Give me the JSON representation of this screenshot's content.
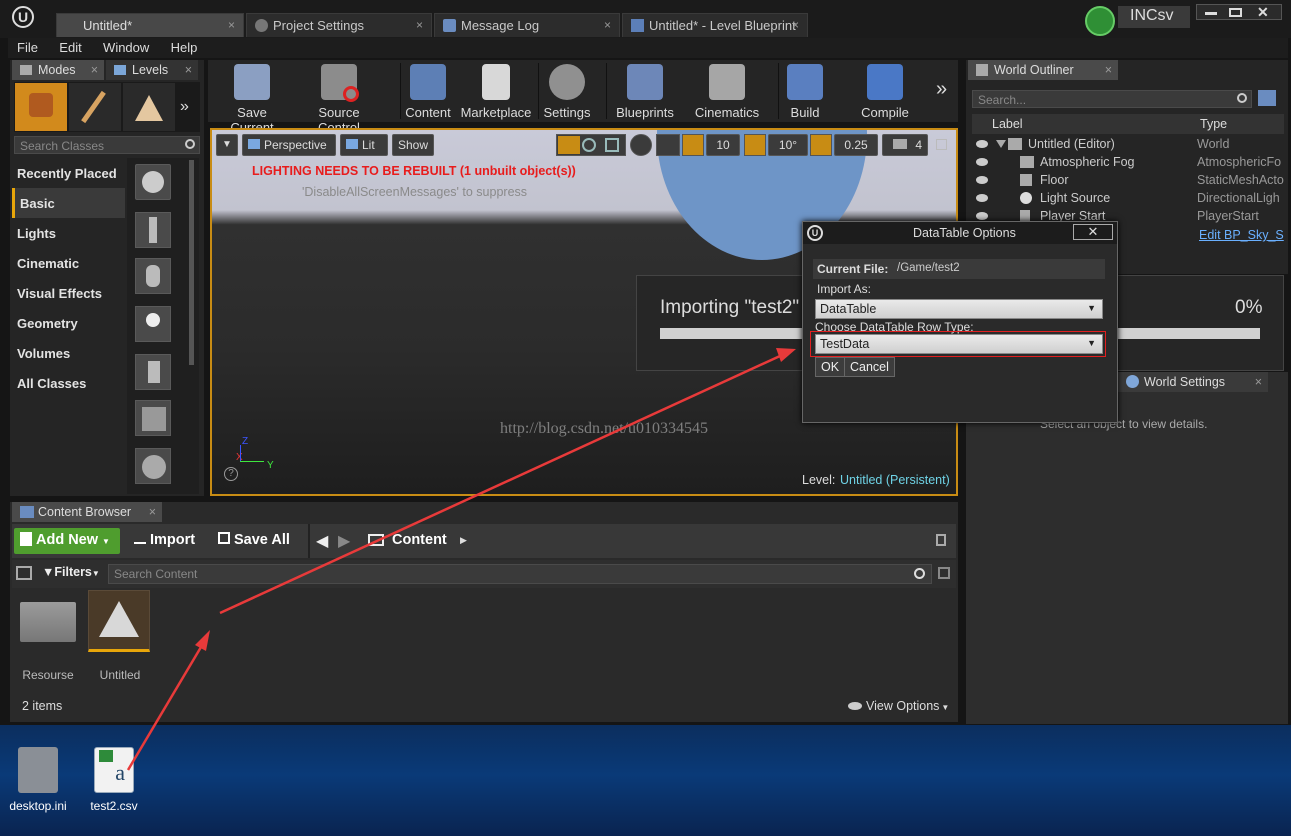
{
  "tabs": [
    {
      "label": "Untitled*",
      "close": "×"
    },
    {
      "label": "Project Settings",
      "close": "×"
    },
    {
      "label": "Message Log",
      "close": "×"
    },
    {
      "label": "Untitled* - Level Blueprint",
      "close": "×"
    }
  ],
  "user": {
    "name": "INCsv"
  },
  "menu": [
    "File",
    "Edit",
    "Window",
    "Help"
  ],
  "modes_tab": {
    "label": "Modes",
    "close": "×"
  },
  "levels_tab": {
    "label": "Levels",
    "close": "×"
  },
  "toolbar": [
    "Save Current",
    "Source Control",
    "Content",
    "Marketplace",
    "Settings",
    "Blueprints",
    "Cinematics",
    "Build",
    "Compile"
  ],
  "place": {
    "search_placeholder": "Search Classes",
    "categories": [
      "Recently Placed",
      "Basic",
      "Lights",
      "Cinematic",
      "Visual Effects",
      "Geometry",
      "Volumes",
      "All Classes"
    ],
    "active_category": "Basic"
  },
  "viewport": {
    "perspective": "Perspective",
    "lit": "Lit",
    "show": "Show",
    "grid_snap": "10",
    "rot_snap": "10°",
    "scale_snap": "0.25",
    "cam_speed": "4",
    "warning": "LIGHTING NEEDS TO BE REBUILT (1 unbuilt object(s))",
    "suppress": "'DisableAllScreenMessages' to suppress",
    "level_label": "Level:",
    "level_name": "Untitled (Persistent)",
    "axis_x": "X",
    "axis_y": "Y",
    "axis_z": "Z"
  },
  "importing": {
    "text": "Importing \"test2\"",
    "percent": "0%",
    "progress": 0
  },
  "dialog": {
    "title": "DataTable Options",
    "current_file_label": "Current File:",
    "current_file": "/Game/test2",
    "import_as_label": "Import As:",
    "import_as": "DataTable",
    "row_type_label": "Choose DataTable Row Type:",
    "row_type": "TestData",
    "ok": "OK",
    "cancel": "Cancel"
  },
  "watermark": "http://blog.csdn.net/u010334545",
  "outliner": {
    "tab": "World Outliner",
    "close": "×",
    "search_placeholder": "Search...",
    "col_label": "Label",
    "col_type": "Type",
    "rows": [
      {
        "label": "Untitled (Editor)",
        "type": "World"
      },
      {
        "label": "Atmospheric Fog",
        "type": "AtmosphericFo"
      },
      {
        "label": "Floor",
        "type": "StaticMeshActo"
      },
      {
        "label": "Light Source",
        "type": "DirectionalLigh"
      },
      {
        "label": "Player Start",
        "type": "PlayerStart"
      }
    ],
    "edit_link": "Edit BP_Sky_S"
  },
  "world_settings": {
    "tab": "World Settings",
    "close": "×",
    "hint": "Select an object to view details."
  },
  "content_browser": {
    "tab": "Content Browser",
    "close": "×",
    "add_new": "Add New",
    "import": "Import",
    "save_all": "Save All",
    "path": "Content",
    "filters": "Filters",
    "search_placeholder": "Search Content",
    "assets": [
      {
        "name": "Resourse"
      },
      {
        "name": "Untitled"
      }
    ],
    "count": "2 items",
    "view_options": "View Options"
  },
  "desktop": [
    {
      "name": "desktop.ini"
    },
    {
      "name": "test2.csv"
    }
  ],
  "colors": {
    "accent": "#e8a60a",
    "warning": "#e81c1c",
    "link": "#6ab0ff",
    "add_new": "#4f9d2e",
    "arrow": "#e83a3a"
  }
}
